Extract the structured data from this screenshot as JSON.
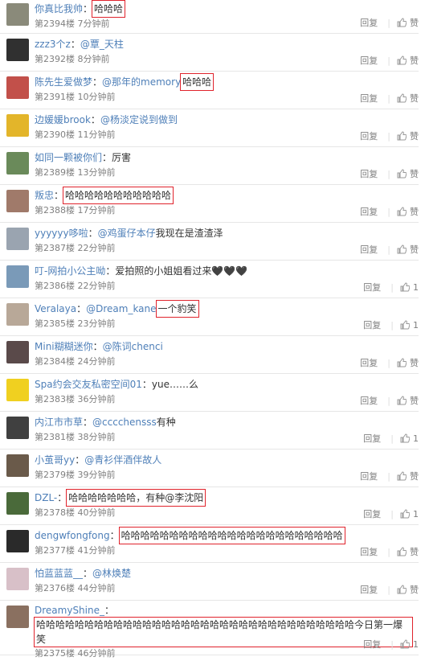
{
  "comments": [
    {
      "user": "你真比我帅",
      "mention": "",
      "text": "哈哈哈",
      "floor": "第2394楼",
      "time": "7分钟前",
      "reply": "回复",
      "like": "赞",
      "avatar": "#8a8a7a",
      "highlight": true
    },
    {
      "user": "zzz3个z",
      "mention": "@覃_天柱",
      "text": "",
      "floor": "第2392楼",
      "time": "8分钟前",
      "reply": "回复",
      "like": "赞",
      "avatar": "#303030",
      "highlight": false
    },
    {
      "user": "陈先生爱做梦",
      "mention": "@那年的memory",
      "text": "哈哈哈",
      "floor": "第2391楼",
      "time": "10分钟前",
      "reply": "回复",
      "like": "赞",
      "avatar": "#c2504a",
      "highlight": true
    },
    {
      "user": "边媛媛brook",
      "mention": "@杨淡定说到做到",
      "text": "",
      "floor": "第2390楼",
      "time": "11分钟前",
      "reply": "回复",
      "like": "赞",
      "avatar": "#e3b52a",
      "highlight": false
    },
    {
      "user": "如同一颗被你们",
      "mention": "",
      "text": "厉害",
      "floor": "第2389楼",
      "time": "13分钟前",
      "reply": "回复",
      "like": "赞",
      "avatar": "#6a8a5a",
      "highlight": false
    },
    {
      "user": "叛忠",
      "mention": "",
      "text": "哈哈哈哈哈哈哈哈哈哈哈",
      "floor": "第2388楼",
      "time": "17分钟前",
      "reply": "回复",
      "like": "赞",
      "avatar": "#a07a6a",
      "highlight": true
    },
    {
      "user": "yyyyyy哆啦",
      "mention": "@鸡蛋仔本仔",
      "text": "我现在是渣渣泽",
      "floor": "第2387楼",
      "time": "22分钟前",
      "reply": "回复",
      "like": "赞",
      "avatar": "#9aa4b0",
      "highlight": false
    },
    {
      "user": "叮-网拍小公主呦",
      "mention": "",
      "text": "爱拍照的小姐姐看过来🖤🖤🖤",
      "floor": "第2386楼",
      "time": "22分钟前",
      "reply": "回复",
      "like": "1",
      "avatar": "#7a9ab8",
      "highlight": false
    },
    {
      "user": "Veralaya",
      "mention": "@Dream_kane",
      "text": "一个豹笑",
      "floor": "第2385楼",
      "time": "23分钟前",
      "reply": "回复",
      "like": "1",
      "avatar": "#b8a898",
      "highlight": true
    },
    {
      "user": "Mini糊糊迷你",
      "mention": "@陈词chenci",
      "text": "",
      "floor": "第2384楼",
      "time": "24分钟前",
      "reply": "回复",
      "like": "赞",
      "avatar": "#5a4a4a",
      "highlight": false
    },
    {
      "user": "Spa约会交友私密空间01",
      "mention": "",
      "text": "yue……么",
      "floor": "第2383楼",
      "time": "36分钟前",
      "reply": "回复",
      "like": "赞",
      "avatar": "#f0d020",
      "highlight": false
    },
    {
      "user": "内江市市草",
      "mention": "@cccchensss",
      "text": "有种",
      "floor": "第2381楼",
      "time": "38分钟前",
      "reply": "回复",
      "like": "1",
      "avatar": "#404040",
      "highlight": false
    },
    {
      "user": "小茧哥yy",
      "mention": "@青衫伴酒伴故人",
      "text": "",
      "floor": "第2379楼",
      "time": "39分钟前",
      "reply": "回复",
      "like": "赞",
      "avatar": "#6a5a4a",
      "highlight": false
    },
    {
      "user": "DZL-",
      "mention": "",
      "text": "哈哈哈哈哈哈哈，有种@李沈阳",
      "floor": "第2378楼",
      "time": "40分钟前",
      "reply": "回复",
      "like": "1",
      "avatar": "#4a6a3a",
      "highlight": true
    },
    {
      "user": "dengwfongfong",
      "mention": "",
      "text": "哈哈哈哈哈哈哈哈哈哈哈哈哈哈哈哈哈哈哈哈哈哈哈",
      "floor": "第2377楼",
      "time": "41分钟前",
      "reply": "回复",
      "like": "赞",
      "avatar": "#2a2a2a",
      "highlight": true
    },
    {
      "user": "怕蓝蓝蓝__",
      "mention": "@林焕楚",
      "text": "",
      "floor": "第2376楼",
      "time": "44分钟前",
      "reply": "回复",
      "like": "赞",
      "avatar": "#d8c0c8",
      "highlight": false
    },
    {
      "user": "DreamyShine_",
      "mention": "",
      "text": "哈哈哈哈哈哈哈哈哈哈哈哈哈哈哈哈哈哈哈哈哈哈哈哈哈哈哈哈哈哈哈哈哈今日第一爆笑",
      "floor": "第2375楼",
      "time": "46分钟前",
      "reply": "回复",
      "like": "1",
      "avatar": "#8a7060",
      "highlight": true
    }
  ],
  "colors": {
    "username": "#4e7fb8",
    "text": "#333333",
    "meta": "#808080",
    "highlight": "#e0232c"
  }
}
